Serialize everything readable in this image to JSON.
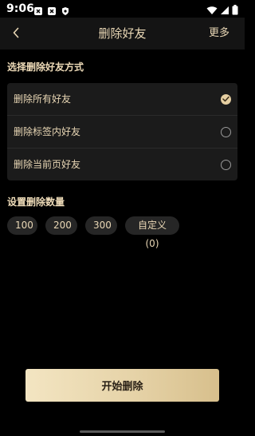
{
  "status_bar": {
    "time": "9:06"
  },
  "header": {
    "title": "删除好友",
    "more_label": "更多"
  },
  "section_method": {
    "title": "选择删除好友方式",
    "options": [
      {
        "label": "删除所有好友",
        "selected": true
      },
      {
        "label": "删除标签内好友",
        "selected": false
      },
      {
        "label": "删除当前页好友",
        "selected": false
      }
    ]
  },
  "section_count": {
    "title": "设置删除数量",
    "chips": [
      "100",
      "200",
      "300",
      "自定义(0)"
    ]
  },
  "start_button": {
    "label": "开始删除"
  },
  "colors": {
    "accent_gold": "#e9d7b5",
    "button_gradient_start": "#f3e5c2",
    "button_gradient_end": "#d7bf8c"
  },
  "icons": {
    "back": "chevron-left-icon",
    "check": "check-circle-icon",
    "radio_empty": "radio-empty-icon"
  }
}
